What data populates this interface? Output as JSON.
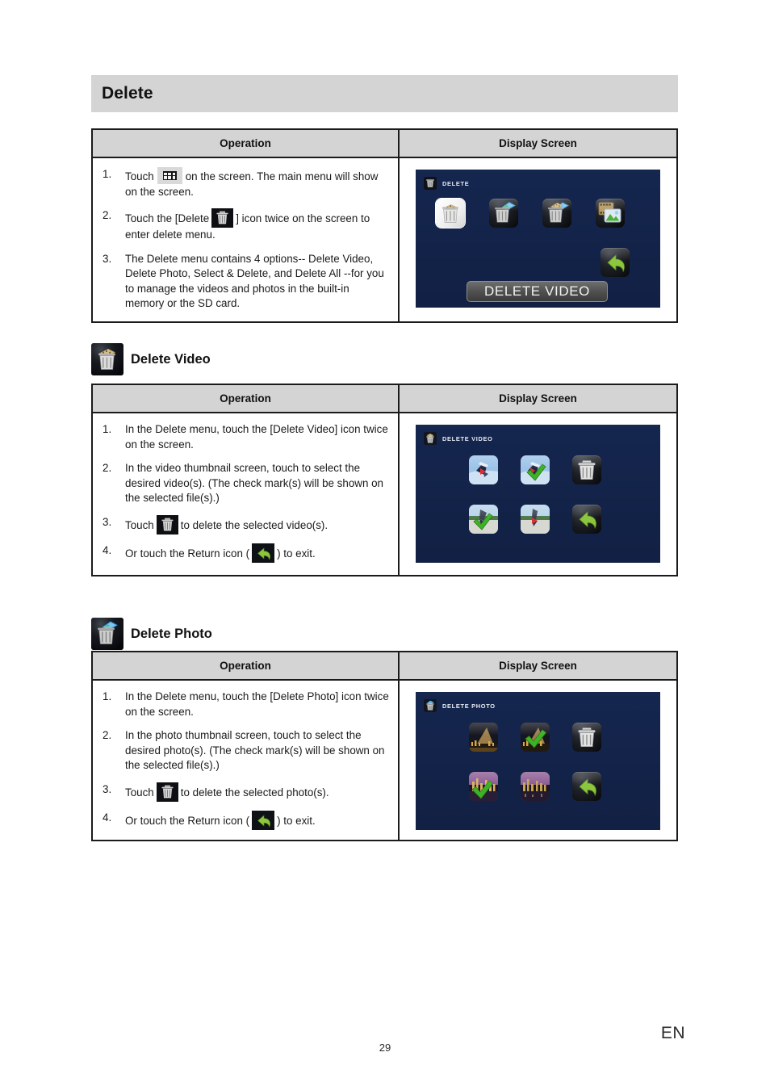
{
  "page": {
    "chapter_title": "Delete",
    "page_number": "29",
    "language_code": "EN"
  },
  "colors": {
    "banner_bg": "#d4d4d4",
    "table_header_bg": "#d4d4d4",
    "table_border": "#1b1b1b",
    "screen_bg": "#15264f",
    "check_mark_green": "#4caf28",
    "play_triangle_red": "#e03030",
    "return_arrow_green": "#8cc63f",
    "caption_pill_gray": "#4e4e4e"
  },
  "table_headers": {
    "operation": "Operation",
    "display_screen": "Display Screen"
  },
  "sections": [
    {
      "id": "delete-menu",
      "heading": "",
      "heading_icon": "",
      "steps": [
        {
          "before": "Touch",
          "icon": "grid-menu-icon",
          "after": "on the screen. The main menu will show on the screen."
        },
        {
          "before": "Touch the [Delete",
          "icon": "trash-icon",
          "after": "] icon twice on the screen to enter delete menu."
        },
        {
          "before": "The Delete menu contains 4 options-- Delete Video, Delete Photo, Select & Delete, and Delete All --for you to manage the videos and photos in the built-in memory or the SD card.",
          "icon": "",
          "after": ""
        }
      ],
      "screen": {
        "title_label": "DELETE",
        "title_icon": "trash-icon",
        "caption": "DELETE VIDEO",
        "tiles": [
          {
            "name": "delete-video-tile",
            "icon": "trash-film-icon",
            "selected": true
          },
          {
            "name": "delete-photo-tile",
            "icon": "trash-photo-icon",
            "selected": false
          },
          {
            "name": "select-and-delete-tile",
            "icon": "trash-film-photo-icon",
            "selected": false
          },
          {
            "name": "delete-all-tile",
            "icon": "film-photo-icon",
            "selected": false
          },
          {
            "name": "return-tile",
            "icon": "return-arrow-icon",
            "selected": false
          }
        ]
      }
    },
    {
      "id": "delete-video",
      "heading": "Delete Video",
      "heading_icon": "trash-film-icon",
      "steps": [
        {
          "before": "In the Delete menu, touch the [Delete Video] icon twice on the screen.",
          "icon": "",
          "after": ""
        },
        {
          "before": "In the video thumbnail screen, touch to select the desired video(s). (The check mark(s) will be shown on the selected file(s).)",
          "icon": "",
          "after": ""
        },
        {
          "before": "Touch",
          "icon": "trash-icon",
          "after": "to delete the selected video(s)."
        },
        {
          "before": "Or touch the Return icon (",
          "icon": "return-arrow-icon",
          "after": ") to exit."
        }
      ],
      "screen": {
        "title_label": "DELETE VIDEO",
        "title_icon": "trash-film-icon",
        "caption": "",
        "thumbnails": [
          {
            "name": "video-thumbnail-1",
            "art": "skate-air",
            "checked": false,
            "play": true
          },
          {
            "name": "video-thumbnail-2",
            "art": "skate-air",
            "checked": true,
            "play": true
          },
          {
            "name": "trash-button",
            "art": "trash",
            "checked": false,
            "play": false
          },
          {
            "name": "video-thumbnail-3",
            "art": "skate-ground",
            "checked": true,
            "play": false
          },
          {
            "name": "video-thumbnail-4",
            "art": "skate-ground",
            "checked": false,
            "play": true
          },
          {
            "name": "return-button",
            "art": "return",
            "checked": false,
            "play": false
          }
        ]
      }
    },
    {
      "id": "delete-photo",
      "heading": "Delete Photo",
      "heading_icon": "trash-photo-icon",
      "steps": [
        {
          "before": "In the Delete menu, touch the [Delete Photo] icon twice on the screen.",
          "icon": "",
          "after": ""
        },
        {
          "before": "In the photo thumbnail screen, touch to select the desired photo(s). (The check mark(s) will be shown on the selected file(s).)",
          "icon": "",
          "after": ""
        },
        {
          "before": "Touch",
          "icon": "trash-icon",
          "after": "to delete the selected photo(s)."
        },
        {
          "before": "Or touch the Return icon (",
          "icon": "return-arrow-icon",
          "after": ") to exit."
        }
      ],
      "screen": {
        "title_label": "DELETE PHOTO",
        "title_icon": "trash-photo-icon",
        "caption": "",
        "thumbnails": [
          {
            "name": "photo-thumbnail-1",
            "art": "city-night-amber",
            "checked": false,
            "play": false
          },
          {
            "name": "photo-thumbnail-2",
            "art": "city-night-amber",
            "checked": true,
            "play": false
          },
          {
            "name": "trash-button",
            "art": "trash",
            "checked": false,
            "play": false
          },
          {
            "name": "photo-thumbnail-3",
            "art": "city-night-purple",
            "checked": true,
            "play": false
          },
          {
            "name": "photo-thumbnail-4",
            "art": "city-night-purple",
            "checked": false,
            "play": false
          },
          {
            "name": "return-button",
            "art": "return",
            "checked": false,
            "play": false
          }
        ]
      }
    }
  ]
}
